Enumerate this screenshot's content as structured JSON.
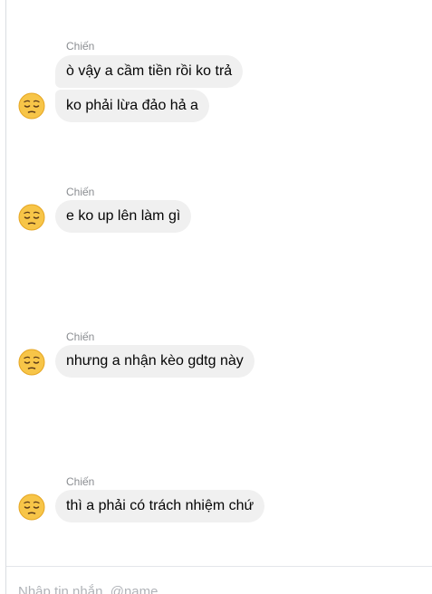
{
  "conversation": {
    "groups": [
      {
        "sender": "Chiến",
        "messages": [
          "ò vậy a cầm tiền rồi ko trả",
          "ko phải lừa đảo hả a"
        ]
      },
      {
        "sender": "Chiến",
        "messages": [
          "e ko up lên làm gì"
        ]
      },
      {
        "sender": "Chiến",
        "messages": [
          "nhưng a nhận kèo gdtg này"
        ]
      },
      {
        "sender": "Chiến",
        "messages": [
          "thì a phải có trách nhiệm chứ"
        ]
      }
    ]
  },
  "avatar": {
    "icon": "pensive-face-emoji-icon",
    "colors": {
      "face": "#f7c548",
      "edge": "#e6a623",
      "features": "#5b3a18"
    }
  },
  "composer": {
    "placeholder": "Nhập tin nhắn, @name"
  },
  "colors": {
    "bubble_bg": "#f0f0f0",
    "sender_text": "#8a8d91",
    "message_text": "#050505"
  }
}
